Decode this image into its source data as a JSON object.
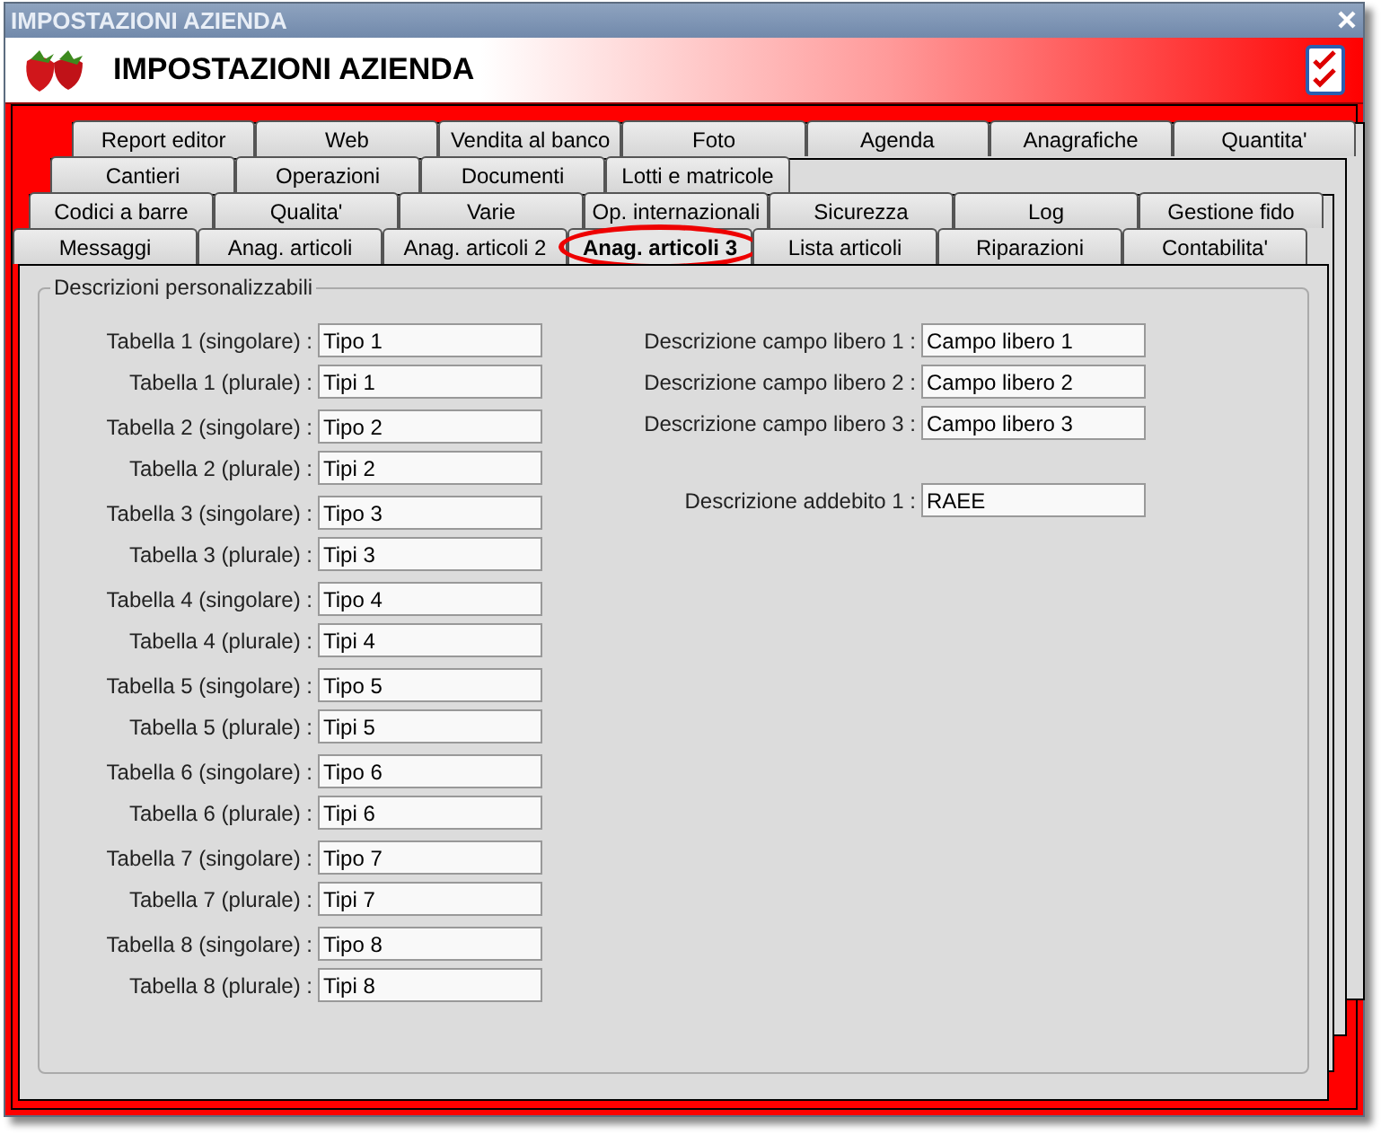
{
  "window": {
    "title": "IMPOSTAZIONI AZIENDA"
  },
  "header": {
    "title": "IMPOSTAZIONI AZIENDA"
  },
  "tab_rows": [
    [
      {
        "label": "Report editor",
        "selected": false,
        "circled": false
      },
      {
        "label": "Web",
        "selected": false,
        "circled": false
      },
      {
        "label": "Vendita al banco",
        "selected": false,
        "circled": false
      },
      {
        "label": "Foto",
        "selected": false,
        "circled": false
      },
      {
        "label": "Agenda",
        "selected": false,
        "circled": false
      },
      {
        "label": "Anagrafiche",
        "selected": false,
        "circled": false
      },
      {
        "label": "Quantita'",
        "selected": false,
        "circled": false
      }
    ],
    [
      {
        "label": "Cantieri",
        "selected": false,
        "circled": false
      },
      {
        "label": "Operazioni",
        "selected": false,
        "circled": false
      },
      {
        "label": "Documenti",
        "selected": false,
        "circled": false
      },
      {
        "label": "Lotti e matricole",
        "selected": false,
        "circled": false
      }
    ],
    [
      {
        "label": "Codici a barre",
        "selected": false,
        "circled": false
      },
      {
        "label": "Qualita'",
        "selected": false,
        "circled": false
      },
      {
        "label": "Varie",
        "selected": false,
        "circled": false
      },
      {
        "label": "Op. internazionali",
        "selected": false,
        "circled": false
      },
      {
        "label": "Sicurezza",
        "selected": false,
        "circled": false
      },
      {
        "label": "Log",
        "selected": false,
        "circled": false
      },
      {
        "label": "Gestione fido",
        "selected": false,
        "circled": false
      }
    ],
    [
      {
        "label": "Messaggi",
        "selected": false,
        "circled": false
      },
      {
        "label": "Anag. articoli",
        "selected": false,
        "circled": false
      },
      {
        "label": "Anag. articoli 2",
        "selected": false,
        "circled": false
      },
      {
        "label": "Anag. articoli 3",
        "selected": true,
        "circled": true
      },
      {
        "label": "Lista articoli",
        "selected": false,
        "circled": false
      },
      {
        "label": "Riparazioni",
        "selected": false,
        "circled": false
      },
      {
        "label": "Contabilita'",
        "selected": false,
        "circled": false
      }
    ]
  ],
  "group": {
    "title": "Descrizioni personalizzabili",
    "left_groups": [
      [
        {
          "label": "Tabella 1 (singolare) :",
          "value": "Tipo 1"
        },
        {
          "label": "Tabella 1 (plurale) :",
          "value": "Tipi 1"
        }
      ],
      [
        {
          "label": "Tabella 2 (singolare) :",
          "value": "Tipo 2"
        },
        {
          "label": "Tabella 2 (plurale) :",
          "value": "Tipi 2"
        }
      ],
      [
        {
          "label": "Tabella 3 (singolare) :",
          "value": "Tipo 3"
        },
        {
          "label": "Tabella 3 (plurale) :",
          "value": "Tipi 3"
        }
      ],
      [
        {
          "label": "Tabella 4 (singolare) :",
          "value": "Tipo 4"
        },
        {
          "label": "Tabella 4 (plurale) :",
          "value": "Tipi 4"
        }
      ],
      [
        {
          "label": "Tabella 5 (singolare) :",
          "value": "Tipo 5"
        },
        {
          "label": "Tabella 5 (plurale) :",
          "value": "Tipi 5"
        }
      ],
      [
        {
          "label": "Tabella 6 (singolare) :",
          "value": "Tipo 6"
        },
        {
          "label": "Tabella 6 (plurale) :",
          "value": "Tipi 6"
        }
      ],
      [
        {
          "label": "Tabella 7 (singolare) :",
          "value": "Tipo 7"
        },
        {
          "label": "Tabella 7 (plurale) :",
          "value": "Tipi 7"
        }
      ],
      [
        {
          "label": "Tabella 8 (singolare) :",
          "value": "Tipo 8"
        },
        {
          "label": "Tabella 8 (plurale) :",
          "value": "Tipi 8"
        }
      ]
    ],
    "right_groups": [
      [
        {
          "label": "Descrizione campo libero 1 :",
          "value": "Campo libero 1"
        },
        {
          "label": "Descrizione campo libero 2 :",
          "value": "Campo libero 2"
        },
        {
          "label": "Descrizione campo libero 3 :",
          "value": "Campo libero 3"
        }
      ],
      [
        {
          "label": "Descrizione addebito 1 :",
          "value": "RAEE"
        }
      ]
    ]
  }
}
